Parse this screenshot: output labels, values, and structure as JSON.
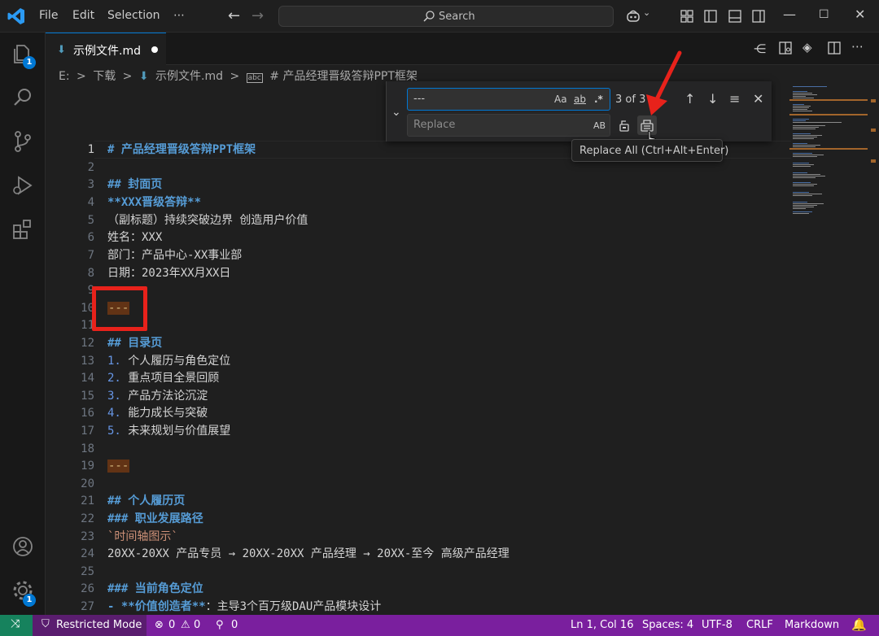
{
  "titlebar": {
    "menus": [
      "File",
      "Edit",
      "Selection",
      "⋯"
    ],
    "search_label": "Search"
  },
  "activity": {
    "explorer_badge": "1",
    "settings_badge": "1"
  },
  "tab": {
    "label": "示例文件.md"
  },
  "breadcrumb": [
    "E:",
    ">",
    "下载",
    ">",
    "示例文件.md",
    ">",
    "# 产品经理晋级答辩PPT框架"
  ],
  "find": {
    "value": "---",
    "match_case": "Aa",
    "whole_word": "ab",
    "regex": ".*",
    "count": "3 of 3",
    "replace_placeholder": "Replace",
    "preserve_case": "AB"
  },
  "tooltip": "Replace All (Ctrl+Alt+Enter)",
  "editor": {
    "line_numbers": [
      "1",
      "2",
      "3",
      "4",
      "5",
      "6",
      "7",
      "8",
      "9",
      "10",
      "11",
      "12",
      "13",
      "14",
      "15",
      "16",
      "17",
      "18",
      "19",
      "20",
      "21",
      "22",
      "23",
      "24",
      "25",
      "26",
      "27"
    ],
    "lines": {
      "l1": "# 产品经理晋级答辩PPT框架",
      "l3": "## 封面页",
      "l4": "**XXX晋级答辩**",
      "l5": "（副标题）持续突破边界 创造用户价值",
      "l6": "姓名：XXX",
      "l7": "部门：产品中心-XX事业部",
      "l8": "日期：2023年XX月XX日",
      "l10": "---",
      "l12": "## 目录页",
      "l13_num": "1.",
      "l13_text": " 个人履历与角色定位",
      "l14_num": "2.",
      "l14_text": " 重点项目全景回顾",
      "l15_num": "3.",
      "l15_text": " 产品方法论沉淀",
      "l16_num": "4.",
      "l16_text": " 能力成长与突破",
      "l17_num": "5.",
      "l17_text": " 未来规划与价值展望",
      "l19": "---",
      "l21": "## 个人履历页",
      "l22": "### 职业发展路径",
      "l23": "`时间轴图示`",
      "l24": "20XX-20XX 产品专员 → 20XX-20XX 产品经理 → 20XX-至今 高级产品经理",
      "l26": "### 当前角色定位",
      "l27_bold": "- **价值创造者**",
      "l27_text": "：主导3个百万级DAU产品模块设计"
    }
  },
  "status": {
    "restricted": "Restricted Mode",
    "errors": "0",
    "warnings": "0",
    "ports": "0",
    "position": "Ln 1, Col 16",
    "spaces": "Spaces: 4",
    "encoding": "UTF-8",
    "eol": "CRLF",
    "language": "Markdown"
  },
  "colors": {
    "accent": "#0078d4",
    "statusbar": "#7a1f9e",
    "find_highlight": "#623315",
    "annotation": "#e8221b"
  }
}
